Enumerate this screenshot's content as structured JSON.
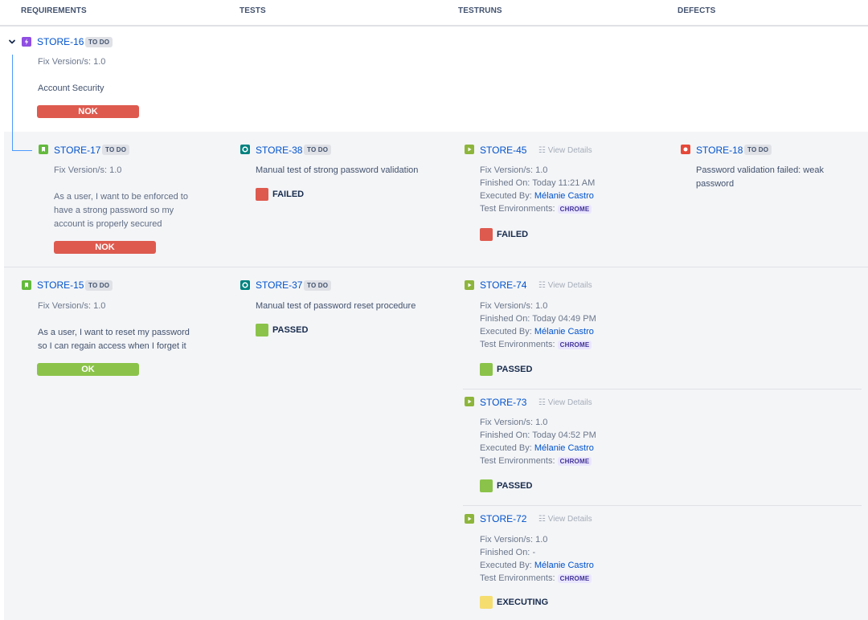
{
  "headers": {
    "requirements": "REQUIREMENTS",
    "tests": "TESTS",
    "testruns": "TESTRUNS",
    "defects": "DEFECTS"
  },
  "colors": {
    "nok": "#de5a4f",
    "ok": "#8bc34a",
    "failed": "#de5a4f",
    "passed": "#8bc34a",
    "executing": "#f6dd70",
    "link": "#0052cc"
  },
  "parent": {
    "icon": "epic-icon",
    "key": "STORE-16",
    "status": "TO DO",
    "fix_version": "Fix Version/s: 1.0",
    "summary": "Account Security",
    "coverage": "NOK"
  },
  "rows": [
    {
      "requirement": {
        "icon": "story-icon",
        "key": "STORE-17",
        "status": "TO DO",
        "fix_version": "Fix Version/s: 1.0",
        "summary_lines": [
          "As a user, I want to be enforced to",
          "have a strong password so my",
          "account is properly secured"
        ],
        "coverage": "NOK"
      },
      "test": {
        "icon": "test-icon",
        "key": "STORE-38",
        "status": "TO DO",
        "summary": "Manual test of strong password validation",
        "result": "FAILED"
      },
      "testruns": [
        {
          "icon": "run-icon",
          "key": "STORE-45",
          "view_details": "View Details",
          "fix_version": "Fix Version/s: 1.0",
          "finished_label": "Finished On:",
          "finished_value": "Today 11:21 AM",
          "executed_label": "Executed By:",
          "executed_by": "Mélanie Castro",
          "env_label": "Test Environments:",
          "env": "CHROME",
          "result": "FAILED"
        }
      ],
      "defect": {
        "icon": "bug-icon",
        "key": "STORE-18",
        "status": "TO DO",
        "summary_lines": [
          "Password validation failed: weak",
          "password"
        ]
      }
    },
    {
      "requirement": {
        "icon": "story-icon",
        "key": "STORE-15",
        "status": "TO DO",
        "fix_version": "Fix Version/s: 1.0",
        "summary_lines": [
          "As a user, I want to reset my password",
          "so I can regain access when I forget it"
        ],
        "coverage": "OK"
      },
      "test": {
        "icon": "test-icon",
        "key": "STORE-37",
        "status": "TO DO",
        "summary": "Manual test of password reset procedure",
        "result": "PASSED"
      },
      "testruns": [
        {
          "icon": "run-icon",
          "key": "STORE-74",
          "view_details": "View Details",
          "fix_version": "Fix Version/s: 1.0",
          "finished_label": "Finished On:",
          "finished_value": "Today 04:49 PM",
          "executed_label": "Executed By:",
          "executed_by": "Mélanie Castro",
          "env_label": "Test Environments:",
          "env": "CHROME",
          "result": "PASSED"
        },
        {
          "icon": "run-icon",
          "key": "STORE-73",
          "view_details": "View Details",
          "fix_version": "Fix Version/s: 1.0",
          "finished_label": "Finished On:",
          "finished_value": "Today 04:52 PM",
          "executed_label": "Executed By:",
          "executed_by": "Mélanie Castro",
          "env_label": "Test Environments:",
          "env": "CHROME",
          "result": "PASSED"
        },
        {
          "icon": "run-icon",
          "key": "STORE-72",
          "view_details": "View Details",
          "fix_version": "Fix Version/s: 1.0",
          "finished_label": "Finished On:",
          "finished_value": "-",
          "executed_label": "Executed By:",
          "executed_by": "Mélanie Castro",
          "env_label": "Test Environments:",
          "env": "CHROME",
          "result": "EXECUTING"
        }
      ]
    }
  ]
}
